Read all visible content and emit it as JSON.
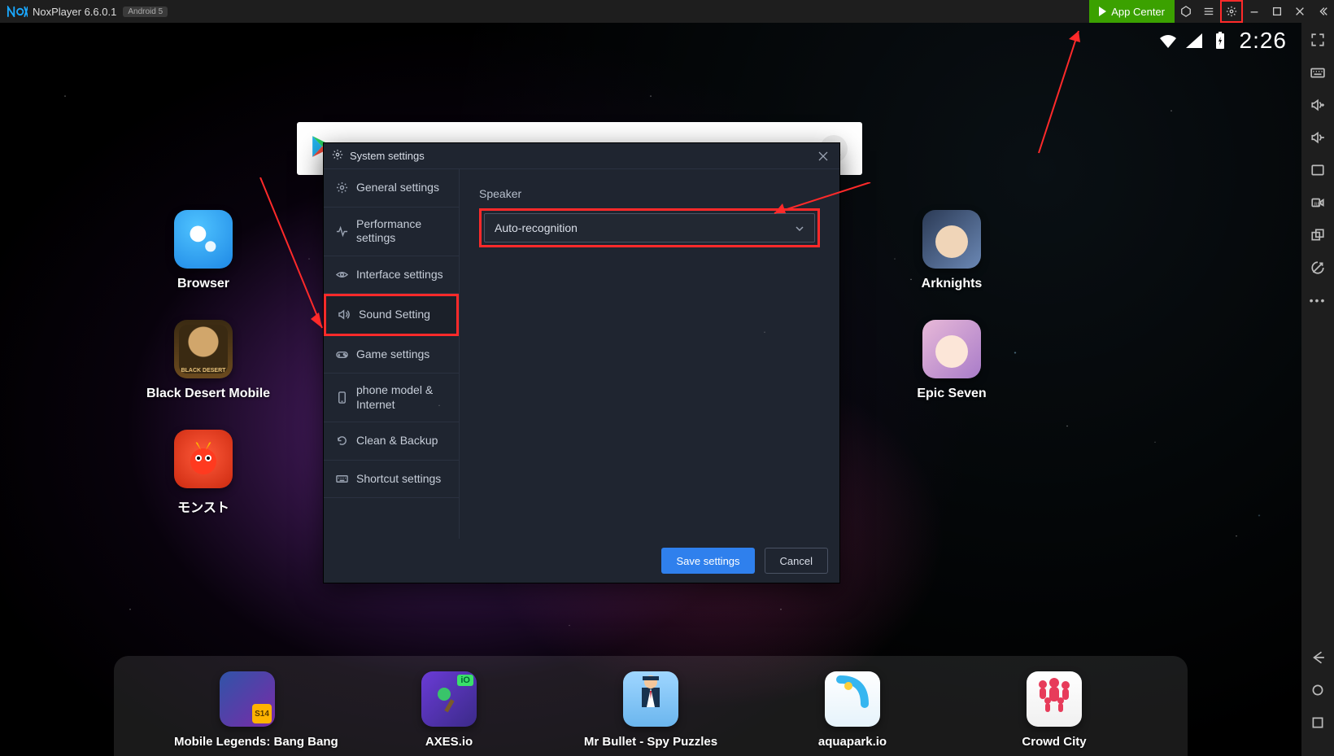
{
  "titlebar": {
    "app_name": "NoxPlayer 6.6.0.1",
    "android_badge": "Android 5",
    "app_center_label": "App Center"
  },
  "status": {
    "time": "2:26"
  },
  "desktop": {
    "icons": [
      {
        "id": "browser",
        "label": "Browser"
      },
      {
        "id": "black-desert",
        "label": "Black Desert Mobile"
      },
      {
        "id": "monst",
        "label": "モンスト"
      },
      {
        "id": "arknights",
        "label": "Arknights"
      },
      {
        "id": "epic-seven",
        "label": "Epic Seven"
      }
    ]
  },
  "dock": {
    "items": [
      {
        "id": "mlbb",
        "label": "Mobile Legends: Bang Bang"
      },
      {
        "id": "axes",
        "label": "AXES.io"
      },
      {
        "id": "mr-bullet",
        "label": "Mr Bullet - Spy Puzzles"
      },
      {
        "id": "aquapark",
        "label": "aquapark.io"
      },
      {
        "id": "crowd-city",
        "label": "Crowd City"
      }
    ]
  },
  "dialog": {
    "title": "System settings",
    "nav": [
      "General settings",
      "Performance settings",
      "Interface settings",
      "Sound Setting",
      "Game settings",
      "phone model & Internet",
      "Clean & Backup",
      "Shortcut settings"
    ],
    "speaker_label": "Speaker",
    "speaker_value": "Auto-recognition",
    "save_label": "Save settings",
    "cancel_label": "Cancel"
  }
}
